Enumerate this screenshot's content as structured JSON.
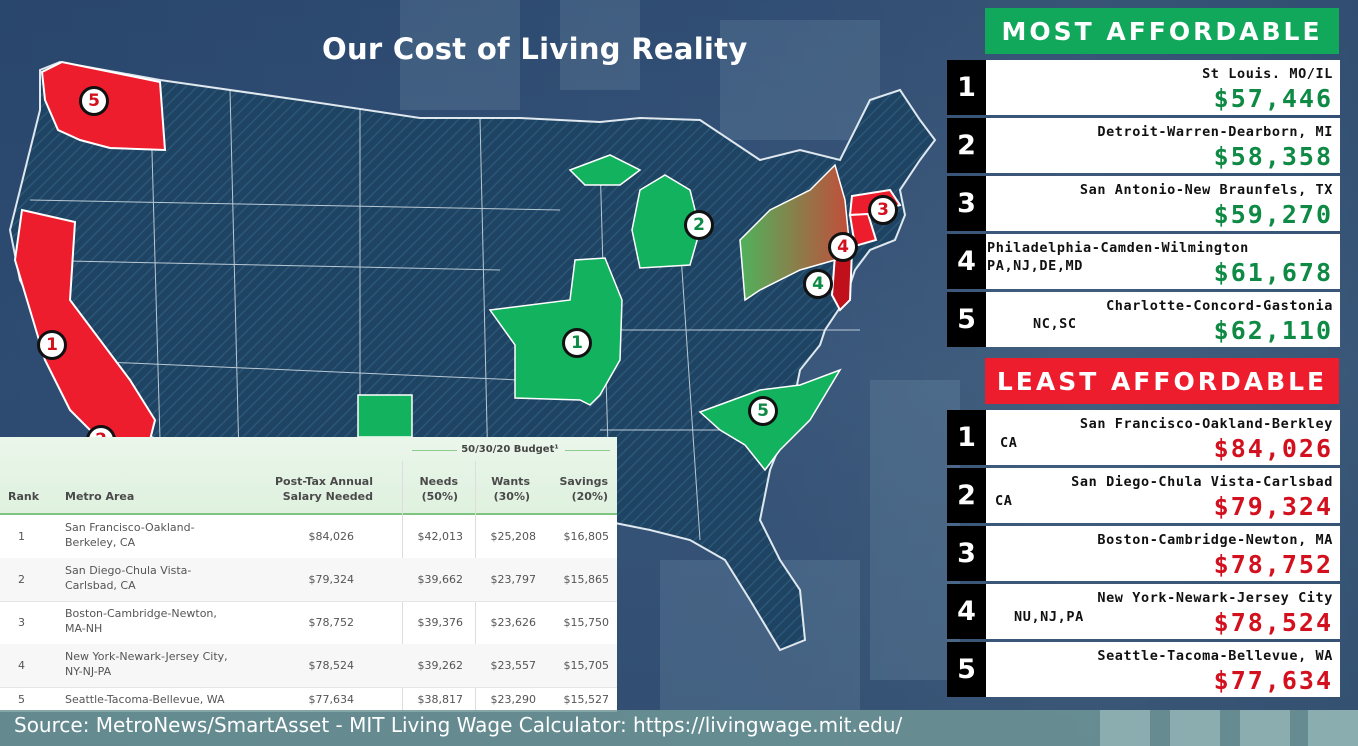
{
  "title": "Our Cost of Living Reality",
  "most_affordable": {
    "heading": "MOST AFFORDABLE",
    "items": [
      {
        "rank": "1",
        "name": "St Louis. MO/IL",
        "sub": "",
        "amount": "$57,446"
      },
      {
        "rank": "2",
        "name": "Detroit-Warren-Dearborn, MI",
        "sub": "",
        "amount": "$58,358"
      },
      {
        "rank": "3",
        "name": "San Antonio-New Braunfels, TX",
        "sub": "",
        "amount": "$59,270"
      },
      {
        "rank": "4",
        "name": "Philadelphia-Camden-Wilmington",
        "sub": "PA,NJ,DE,MD",
        "amount": "$61,678"
      },
      {
        "rank": "5",
        "name": "Charlotte-Concord-Gastonia",
        "sub": "NC,SC",
        "amount": "$62,110"
      }
    ]
  },
  "least_affordable": {
    "heading": "LEAST AFFORDABLE",
    "items": [
      {
        "rank": "1",
        "name": "San Francisco-Oakland-Berkley",
        "sub": "CA",
        "amount": "$84,026"
      },
      {
        "rank": "2",
        "name": "San Diego-Chula Vista-Carlsbad",
        "sub": "CA",
        "amount": "$79,324"
      },
      {
        "rank": "3",
        "name": "Boston-Cambridge-Newton, MA",
        "sub": "",
        "amount": "$78,752"
      },
      {
        "rank": "4",
        "name": "New York-Newark-Jersey City",
        "sub": "NU,NJ,PA",
        "amount": "$78,524"
      },
      {
        "rank": "5",
        "name": "Seattle-Tacoma-Bellevue, WA",
        "sub": "",
        "amount": "$77,634"
      }
    ]
  },
  "table": {
    "budget_header": "50/30/20 Budget¹",
    "columns": {
      "rank": "Rank",
      "metro": "Metro Area",
      "salary_1": "Post-Tax Annual",
      "salary_2": "Salary Needed",
      "needs_1": "Needs",
      "needs_2": "(50%)",
      "wants_1": "Wants",
      "wants_2": "(30%)",
      "savings_1": "Savings",
      "savings_2": "(20%)"
    },
    "rows": [
      {
        "rank": "1",
        "metro_1": "San Francisco-Oakland-",
        "metro_2": "Berkeley, CA",
        "salary": "$84,026",
        "needs": "$42,013",
        "wants": "$25,208",
        "savings": "$16,805"
      },
      {
        "rank": "2",
        "metro_1": "San Diego-Chula Vista-",
        "metro_2": "Carlsbad, CA",
        "salary": "$79,324",
        "needs": "$39,662",
        "wants": "$23,797",
        "savings": "$15,865"
      },
      {
        "rank": "3",
        "metro_1": "Boston-Cambridge-Newton,",
        "metro_2": "MA-NH",
        "salary": "$78,752",
        "needs": "$39,376",
        "wants": "$23,626",
        "savings": "$15,750"
      },
      {
        "rank": "4",
        "metro_1": "New York-Newark-Jersey City,",
        "metro_2": "NY-NJ-PA",
        "salary": "$78,524",
        "needs": "$39,262",
        "wants": "$23,557",
        "savings": "$15,705"
      },
      {
        "rank": "5",
        "metro_1": "Seattle-Tacoma-Bellevue, WA",
        "metro_2": "",
        "salary": "$77,634",
        "needs": "$38,817",
        "wants": "$23,290",
        "savings": "$15,527"
      }
    ]
  },
  "map_badges": {
    "red": [
      "5",
      "1",
      "3",
      "4",
      "2"
    ],
    "green": [
      "2",
      "1",
      "4",
      "5"
    ]
  },
  "source": "Source: MetroNews/SmartAsset - MIT Living Wage Calculator: https://livingwage.mit.edu/",
  "colors": {
    "affordable": "#11a85c",
    "unaffordable": "#ee1d2e",
    "map_states": "#1f4463",
    "rank_box": "#000000"
  }
}
